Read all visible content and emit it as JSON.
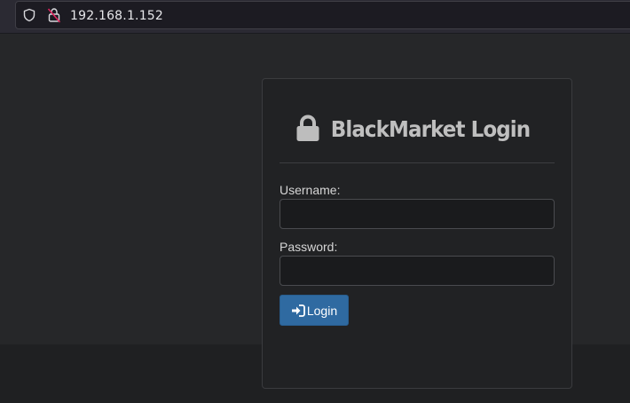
{
  "browser": {
    "url": "192.168.1.152",
    "icons": [
      "shield-icon",
      "insecure-connection-icon"
    ]
  },
  "login": {
    "title": "BlackMarket Login",
    "title_icon": "lock-icon",
    "username_label": "Username:",
    "username_value": "",
    "password_label": "Password:",
    "password_value": "",
    "button_label": "Login",
    "button_icon": "sign-in-icon"
  },
  "colors": {
    "page_background": "#262729",
    "panel_background": "#212224",
    "button_primary": "#2f6aa1",
    "title_text": "#bfbfbf"
  }
}
